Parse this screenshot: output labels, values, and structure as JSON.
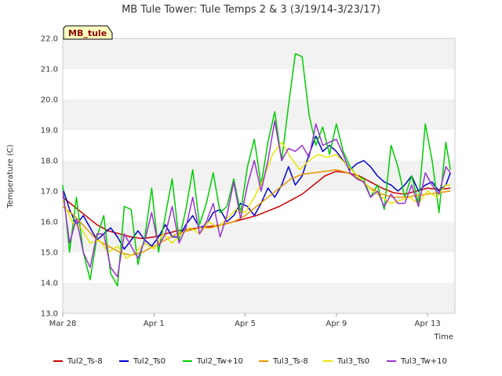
{
  "chart_data": {
    "type": "line",
    "title": "MB Tule Tower: Tule Temps 2 & 3 (3/19/14-3/23/17)",
    "xlabel": "Time",
    "ylabel": "Temperature (C)",
    "badge": "MB_tule",
    "ylim": [
      13.0,
      22.0
    ],
    "xlim": [
      0,
      17.2
    ],
    "grid": "horizontal bands",
    "legend_position": "bottom",
    "y_ticks": [
      "13.0",
      "14.0",
      "15.0",
      "16.0",
      "17.0",
      "18.0",
      "19.0",
      "20.0",
      "21.0",
      "22.0"
    ],
    "x_ticks": [
      {
        "label": "Mar 28",
        "x": 0
      },
      {
        "label": "Apr 1",
        "x": 4
      },
      {
        "label": "Apr 5",
        "x": 8
      },
      {
        "label": "Apr 9",
        "x": 12
      },
      {
        "label": "Apr 13",
        "x": 16
      }
    ],
    "series": [
      {
        "name": "Tul2_Ts-8",
        "color": "#cc0000",
        "x": [
          0.0,
          0.5,
          1.0,
          1.5,
          2.0,
          2.5,
          3.0,
          3.5,
          4.0,
          4.5,
          5.0,
          5.5,
          6.0,
          6.5,
          7.0,
          7.5,
          8.0,
          8.5,
          9.0,
          9.5,
          10.0,
          10.5,
          11.0,
          11.5,
          12.0,
          12.5,
          13.0,
          13.5,
          14.0,
          14.5,
          15.0,
          15.5,
          16.0,
          16.5,
          17.0
        ],
        "y": [
          16.8,
          16.5,
          16.2,
          15.9,
          15.7,
          15.6,
          15.5,
          15.45,
          15.5,
          15.6,
          15.7,
          15.75,
          15.8,
          15.85,
          15.9,
          16.0,
          16.1,
          16.2,
          16.35,
          16.5,
          16.7,
          16.9,
          17.2,
          17.5,
          17.65,
          17.6,
          17.5,
          17.3,
          17.1,
          16.95,
          16.9,
          17.0,
          17.1,
          17.05,
          17.1
        ]
      },
      {
        "name": "Tul2_Ts0",
        "color": "#0000cc",
        "x": [
          0.0,
          0.3,
          0.6,
          0.9,
          1.2,
          1.5,
          1.8,
          2.1,
          2.4,
          2.7,
          3.0,
          3.3,
          3.6,
          3.9,
          4.2,
          4.5,
          4.8,
          5.1,
          5.4,
          5.7,
          6.0,
          6.3,
          6.6,
          6.9,
          7.2,
          7.5,
          7.8,
          8.1,
          8.4,
          8.7,
          9.0,
          9.3,
          9.6,
          9.9,
          10.2,
          10.5,
          10.8,
          11.1,
          11.4,
          11.7,
          12.0,
          12.3,
          12.6,
          12.9,
          13.2,
          13.5,
          13.8,
          14.1,
          14.4,
          14.7,
          15.0,
          15.3,
          15.6,
          15.9,
          16.2,
          16.5,
          16.8,
          17.0
        ],
        "y": [
          17.1,
          16.4,
          15.9,
          16.2,
          15.8,
          15.4,
          15.6,
          15.8,
          15.5,
          15.1,
          15.4,
          15.7,
          15.4,
          15.2,
          15.5,
          15.9,
          15.5,
          15.5,
          15.9,
          16.2,
          15.8,
          15.9,
          16.3,
          16.4,
          16.0,
          16.2,
          16.6,
          16.5,
          16.2,
          16.6,
          17.1,
          16.8,
          17.2,
          17.8,
          17.2,
          17.5,
          18.2,
          18.8,
          18.3,
          18.5,
          18.3,
          18.0,
          17.7,
          17.9,
          18.0,
          17.8,
          17.5,
          17.3,
          17.2,
          17.0,
          17.2,
          17.5,
          17.0,
          17.2,
          17.3,
          17.0,
          17.2,
          17.6
        ]
      },
      {
        "name": "Tul2_Tw+10",
        "color": "#00cc00",
        "x": [
          0.0,
          0.3,
          0.6,
          0.9,
          1.2,
          1.5,
          1.8,
          2.1,
          2.4,
          2.7,
          3.0,
          3.3,
          3.6,
          3.9,
          4.2,
          4.5,
          4.8,
          5.1,
          5.4,
          5.7,
          6.0,
          6.3,
          6.6,
          6.9,
          7.2,
          7.5,
          7.8,
          8.1,
          8.4,
          8.7,
          9.0,
          9.3,
          9.6,
          9.9,
          10.2,
          10.5,
          10.8,
          11.1,
          11.4,
          11.7,
          12.0,
          12.3,
          12.6,
          12.9,
          13.2,
          13.5,
          13.8,
          14.1,
          14.4,
          14.7,
          15.0,
          15.3,
          15.6,
          15.9,
          16.2,
          16.5,
          16.8,
          17.0
        ],
        "y": [
          17.2,
          15.0,
          16.8,
          15.0,
          14.1,
          15.5,
          16.2,
          14.3,
          13.9,
          16.5,
          16.4,
          14.6,
          15.5,
          17.1,
          15.0,
          16.2,
          17.4,
          15.4,
          16.4,
          17.7,
          15.9,
          16.6,
          17.6,
          16.3,
          16.5,
          17.4,
          16.3,
          17.8,
          18.7,
          17.2,
          18.6,
          19.6,
          18.0,
          19.8,
          21.5,
          21.4,
          19.5,
          18.5,
          19.1,
          18.2,
          19.2,
          18.3,
          17.8,
          17.5,
          17.4,
          16.8,
          17.2,
          16.4,
          18.5,
          17.8,
          16.8,
          17.5,
          16.6,
          19.2,
          18.0,
          16.3,
          18.6,
          17.7
        ]
      },
      {
        "name": "Tul3_Ts-8",
        "color": "#e69500",
        "x": [
          0.0,
          0.5,
          1.0,
          1.5,
          2.0,
          2.5,
          3.0,
          3.5,
          4.0,
          4.5,
          5.0,
          5.5,
          6.0,
          6.5,
          7.0,
          7.5,
          8.0,
          8.5,
          9.0,
          9.5,
          10.0,
          10.5,
          11.0,
          11.5,
          12.0,
          12.5,
          13.0,
          13.5,
          14.0,
          14.5,
          15.0,
          15.5,
          16.0,
          16.5,
          17.0
        ],
        "y": [
          16.5,
          16.2,
          15.8,
          15.4,
          15.2,
          15.0,
          14.9,
          15.0,
          15.2,
          15.4,
          15.6,
          15.7,
          15.8,
          15.8,
          15.9,
          16.0,
          16.2,
          16.5,
          16.8,
          17.1,
          17.4,
          17.55,
          17.6,
          17.65,
          17.7,
          17.6,
          17.4,
          17.1,
          16.9,
          16.8,
          16.8,
          16.85,
          16.9,
          16.95,
          17.0
        ]
      },
      {
        "name": "Tul3_Ts0",
        "color": "#e6e600",
        "x": [
          0.0,
          0.4,
          0.8,
          1.2,
          1.6,
          2.0,
          2.4,
          2.8,
          3.2,
          3.6,
          4.0,
          4.4,
          4.8,
          5.2,
          5.6,
          6.0,
          6.4,
          6.8,
          7.2,
          7.6,
          8.0,
          8.4,
          8.8,
          9.2,
          9.6,
          10.0,
          10.4,
          10.8,
          11.2,
          11.6,
          12.0,
          12.4,
          12.8,
          13.2,
          13.6,
          14.0,
          14.4,
          14.8,
          15.2,
          15.6,
          16.0,
          16.4,
          16.8,
          17.0
        ],
        "y": [
          16.7,
          16.0,
          15.8,
          15.3,
          15.4,
          15.0,
          15.2,
          14.8,
          15.0,
          15.3,
          15.1,
          15.6,
          15.3,
          15.6,
          15.8,
          15.6,
          16.0,
          15.8,
          16.1,
          16.4,
          16.3,
          16.8,
          17.4,
          18.2,
          18.6,
          18.1,
          17.7,
          18.0,
          18.2,
          18.1,
          18.2,
          17.9,
          17.6,
          17.3,
          17.0,
          16.8,
          16.6,
          16.7,
          16.8,
          16.6,
          17.0,
          16.8,
          17.2,
          17.2
        ]
      },
      {
        "name": "Tul3_Tw+10",
        "color": "#9933cc",
        "x": [
          0.0,
          0.3,
          0.6,
          0.9,
          1.2,
          1.5,
          1.8,
          2.1,
          2.4,
          2.7,
          3.0,
          3.3,
          3.6,
          3.9,
          4.2,
          4.5,
          4.8,
          5.1,
          5.4,
          5.7,
          6.0,
          6.3,
          6.6,
          6.9,
          7.2,
          7.5,
          7.8,
          8.1,
          8.4,
          8.7,
          9.0,
          9.3,
          9.6,
          9.9,
          10.2,
          10.5,
          10.8,
          11.1,
          11.4,
          11.7,
          12.0,
          12.3,
          12.6,
          12.9,
          13.2,
          13.5,
          13.8,
          14.1,
          14.4,
          14.7,
          15.0,
          15.3,
          15.6,
          15.9,
          16.2,
          16.5,
          16.8,
          17.0
        ],
        "y": [
          17.0,
          15.3,
          16.1,
          15.0,
          14.5,
          15.6,
          15.6,
          14.5,
          14.2,
          15.6,
          15.2,
          14.8,
          15.4,
          16.3,
          15.2,
          15.6,
          16.5,
          15.3,
          15.8,
          16.8,
          15.6,
          16.0,
          16.6,
          15.5,
          16.2,
          17.3,
          16.1,
          17.2,
          18.0,
          17.0,
          18.0,
          19.3,
          18.0,
          18.4,
          18.3,
          18.5,
          18.1,
          19.2,
          18.5,
          18.6,
          18.7,
          18.2,
          17.6,
          17.4,
          17.3,
          16.8,
          17.0,
          16.5,
          16.9,
          16.6,
          16.6,
          17.2,
          16.5,
          17.6,
          17.2,
          16.9,
          17.8,
          17.6
        ]
      }
    ]
  }
}
